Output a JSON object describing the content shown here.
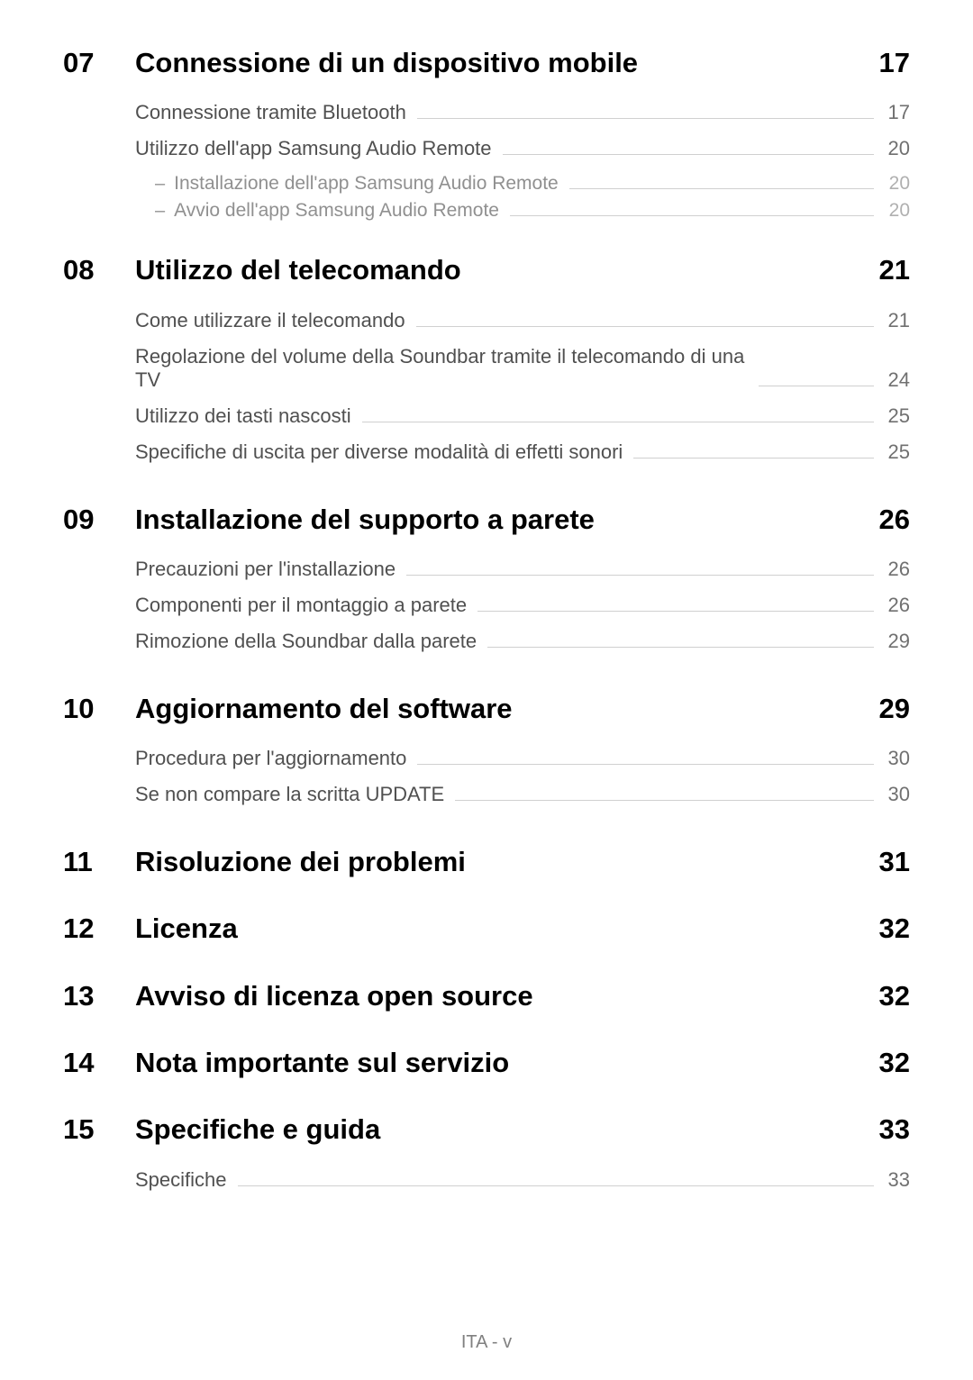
{
  "footer": "ITA - v",
  "sections": [
    {
      "num": "07",
      "title": "Connessione di un dispositivo mobile",
      "page": "17",
      "entries": [
        {
          "text": "Connessione tramite Bluetooth",
          "page": "17",
          "subs": []
        },
        {
          "text": "Utilizzo dell'app Samsung Audio Remote",
          "page": "20",
          "subs": [
            {
              "text": "Installazione dell'app Samsung Audio Remote",
              "page": "20"
            },
            {
              "text": "Avvio dell'app Samsung Audio Remote",
              "page": "20"
            }
          ]
        }
      ]
    },
    {
      "num": "08",
      "title": "Utilizzo del telecomando",
      "page": "21",
      "entries": [
        {
          "text": "Come utilizzare il telecomando",
          "page": "21",
          "subs": []
        },
        {
          "text": "Regolazione del volume della Soundbar tramite il telecomando di una TV",
          "page": "24",
          "subs": []
        },
        {
          "text": "Utilizzo dei tasti nascosti",
          "page": "25",
          "subs": []
        },
        {
          "text": "Specifiche di uscita per diverse modalità di effetti sonori",
          "page": "25",
          "subs": []
        }
      ]
    },
    {
      "num": "09",
      "title": "Installazione del supporto a parete",
      "page": "26",
      "entries": [
        {
          "text": "Precauzioni per l'installazione",
          "page": "26",
          "subs": []
        },
        {
          "text": "Componenti per il montaggio a parete",
          "page": "26",
          "subs": []
        },
        {
          "text": "Rimozione della Soundbar dalla parete",
          "page": "29",
          "subs": []
        }
      ]
    },
    {
      "num": "10",
      "title": "Aggiornamento del software",
      "page": "29",
      "entries": [
        {
          "text": "Procedura per l'aggiornamento",
          "page": "30",
          "subs": []
        },
        {
          "text": "Se non compare la scritta UPDATE",
          "page": "30",
          "subs": []
        }
      ]
    },
    {
      "num": "11",
      "title": "Risoluzione dei problemi",
      "page": "31",
      "entries": []
    },
    {
      "num": "12",
      "title": "Licenza",
      "page": "32",
      "entries": []
    },
    {
      "num": "13",
      "title": "Avviso di licenza open source",
      "page": "32",
      "entries": []
    },
    {
      "num": "14",
      "title": "Nota importante sul servizio",
      "page": "32",
      "entries": []
    },
    {
      "num": "15",
      "title": "Specifiche e guida",
      "page": "33",
      "entries": [
        {
          "text": "Specifiche",
          "page": "33",
          "subs": []
        }
      ]
    }
  ]
}
